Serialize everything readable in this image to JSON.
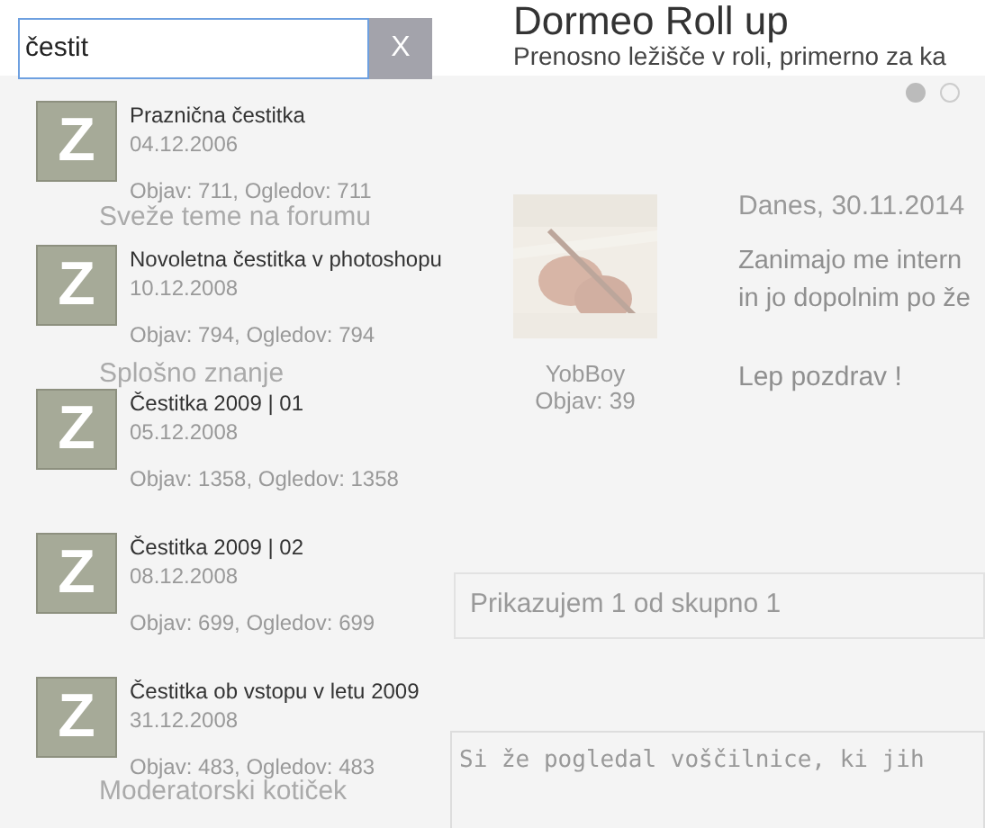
{
  "search": {
    "value": "čestit",
    "clear_label": "X"
  },
  "header": {
    "title": "Dormeo Roll up",
    "subtitle": "Prenosno ležišče v roli, primerno za ka"
  },
  "sidebar": {
    "items": [
      {
        "label": "Sveže teme na forumu"
      },
      {
        "label": "Splošno znanje"
      },
      {
        "label": "Moderatorski kotiček"
      }
    ]
  },
  "carousel_dots": [
    {
      "selected": true
    },
    {
      "selected": false
    }
  ],
  "post": {
    "author": "YobBoy",
    "author_posts": "Objav: 39",
    "date": "Danes, 30.11.2014",
    "lines": [
      "Zanimajo me intern",
      "in jo dopolnim po že"
    ],
    "greeting": "Lep pozdrav !"
  },
  "pager": {
    "text": "Prikazujem 1 od skupno 1"
  },
  "reply_box": {
    "value": "Si že pogledal voščilnice, ki jih"
  },
  "results": [
    {
      "icon": "Z",
      "title": "Praznična čestitka",
      "date": "04.12.2006",
      "stats": "Objav: 711, Ogledov: 711"
    },
    {
      "icon": "Z",
      "title": "Novoletna čestitka v photoshopu",
      "date": "10.12.2008",
      "stats": "Objav: 794, Ogledov: 794"
    },
    {
      "icon": "Z",
      "title": "Čestitka 2009 | 01",
      "date": "05.12.2008",
      "stats": "Objav: 1358, Ogledov: 1358"
    },
    {
      "icon": "Z",
      "title": "Čestitka 2009 | 02",
      "date": "08.12.2008",
      "stats": "Objav: 699, Ogledov: 699"
    },
    {
      "icon": "Z",
      "title": "Čestitka ob vstopu v letu 2009",
      "date": "31.12.2008",
      "stats": "Objav: 483, Ogledov: 483"
    }
  ]
}
